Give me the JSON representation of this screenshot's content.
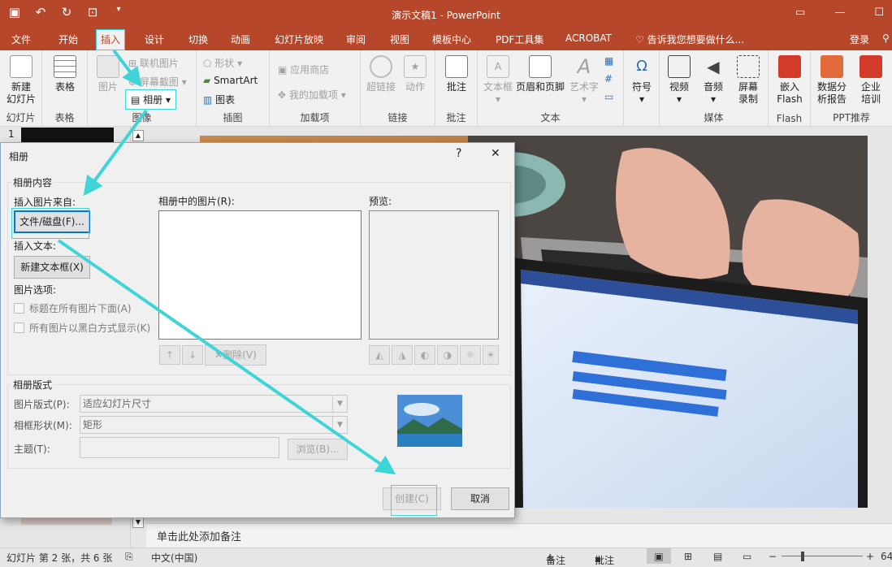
{
  "window": {
    "title": "演示文稿1 - PowerPoint"
  },
  "qat": {
    "save_icon": "save-icon",
    "undo_icon": "undo-icon",
    "redo_icon": "redo-icon",
    "present_icon": "present-icon",
    "customize": "▾"
  },
  "tabs": [
    {
      "label": "文件"
    },
    {
      "label": "开始"
    },
    {
      "label": "插入"
    },
    {
      "label": "设计"
    },
    {
      "label": "切换"
    },
    {
      "label": "动画"
    },
    {
      "label": "幻灯片放映"
    },
    {
      "label": "审阅"
    },
    {
      "label": "视图"
    },
    {
      "label": "模板中心"
    },
    {
      "label": "PDF工具集"
    },
    {
      "label": "ACROBAT"
    }
  ],
  "tellme": "告诉我您想要做什么...",
  "login": "登录",
  "ribbon": {
    "slides": {
      "new_slide_l1": "新建",
      "new_slide_l2": "幻灯片",
      "group": "幻灯片"
    },
    "tables": {
      "table": "表格",
      "group": "表格"
    },
    "images": {
      "picture": "图片",
      "online_pictures": "联机图片",
      "screenshot": "屏幕截图",
      "album": "相册",
      "group": "图像"
    },
    "illustrations": {
      "shapes": "形状",
      "smartart": "SmartArt",
      "chart": "图表",
      "group": "插图"
    },
    "addins": {
      "store": "应用商店",
      "my_addins": "我的加载项",
      "group": "加载项"
    },
    "links": {
      "hyperlink": "超链接",
      "action": "动作",
      "group": "链接"
    },
    "comments": {
      "comment": "批注",
      "group": "批注"
    },
    "text": {
      "textbox": "文本框",
      "headerfooter": "页眉和页脚",
      "wordart": "艺术字",
      "group": "文本"
    },
    "symbols": {
      "symbol": "符号"
    },
    "media": {
      "video": "视频",
      "audio": "音频",
      "screenrec_l1": "屏幕",
      "screenrec_l2": "录制",
      "group": "媒体"
    },
    "flash": {
      "embed_l1": "嵌入",
      "embed_l2": "Flash",
      "group": "Flash"
    },
    "ppt": {
      "report_l1": "数据分",
      "report_l2": "析报告",
      "training_l1": "企业",
      "training_l2": "培训",
      "group": "PPT推荐"
    }
  },
  "left_panel": {
    "slide_number": "1"
  },
  "dialog": {
    "title": "相册",
    "help": "?",
    "close": "✕",
    "content_group": "相册内容",
    "insert_from": "插入图片来自:",
    "file_disk": "文件/磁盘(F)...",
    "insert_text": "插入文本:",
    "new_textbox": "新建文本框(X)",
    "picture_options": "图片选项:",
    "opt_captions": "标题在所有图片下面(A)",
    "opt_bw": "所有图片以黑白方式显示(K)",
    "pictures_in_album": "相册中的图片(R):",
    "preview": "预览:",
    "remove": "删除(V)",
    "layout_group": "相册版式",
    "picture_layout_label": "图片版式(P):",
    "picture_layout_value": "适应幻灯片尺寸",
    "frame_shape_label": "相框形状(M):",
    "frame_shape_value": "矩形",
    "theme_label": "主题(T):",
    "browse": "浏览(B)...",
    "create": "创建(C)",
    "cancel": "取消"
  },
  "notes": {
    "placeholder": "单击此处添加备注"
  },
  "status": {
    "slide_info": "幻灯片 第 2 张，共 6 张",
    "language": "中文(中国)",
    "notes": "备注",
    "comments": "批注",
    "zoom": "64"
  },
  "colors": {
    "accent": "#b7472a",
    "highlight": "#3fd5d8"
  }
}
